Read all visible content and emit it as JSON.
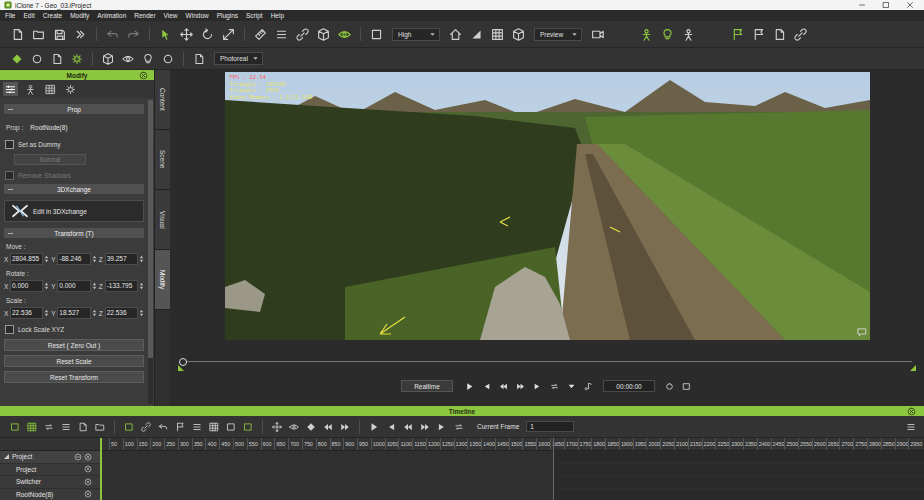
{
  "window": {
    "title": "iClone 7 - Geo_03.iProject"
  },
  "menu": [
    "File",
    "Edit",
    "Create",
    "Modify",
    "Animation",
    "Render",
    "View",
    "Window",
    "Plugins",
    "Script",
    "Help"
  ],
  "toolbar": {
    "quality": "High",
    "view_mode": "Preview",
    "render_mode": "Photoreal"
  },
  "modify_panel": {
    "title": "Modify",
    "icon_tabs": [
      {
        "selected": true
      },
      {
        "selected": false
      },
      {
        "selected": false
      },
      {
        "selected": false
      }
    ],
    "scrollbar": {
      "level": 0.85
    },
    "prop_section": {
      "title": "Prop",
      "prop_label": "Prop :",
      "prop_value": "RootNode(8)",
      "set_as_dummy": {
        "label": "Set as Dummy",
        "checked": false,
        "disabled": false
      },
      "shadow_mode": {
        "value": "Normal",
        "disabled": true
      },
      "remove_shadows": {
        "label": "Remove Shadows",
        "checked": false,
        "disabled": true
      }
    },
    "xchange_section": {
      "title": "3DXchange",
      "button": "Edit in 3DXchange"
    },
    "transform_section": {
      "title": "Transform (T)",
      "groups": [
        {
          "label": "Move :",
          "fields": [
            {
              "axis": "X",
              "value": "2804.855"
            },
            {
              "axis": "Y",
              "value": "-88.246"
            },
            {
              "axis": "Z",
              "value": "39.257"
            }
          ]
        },
        {
          "label": "Rotate :",
          "fields": [
            {
              "axis": "X",
              "value": "0.000"
            },
            {
              "axis": "Y",
              "value": "0.000"
            },
            {
              "axis": "Z",
              "value": "-133.795"
            }
          ]
        },
        {
          "label": "Scale :",
          "fields": [
            {
              "axis": "X",
              "value": "22.536"
            },
            {
              "axis": "Y",
              "value": "18.527"
            },
            {
              "axis": "Z",
              "value": "22.536"
            }
          ]
        }
      ],
      "lock_scale": {
        "label": "Lock Scale XYZ",
        "checked": false,
        "disabled": false
      },
      "buttons": [
        "Reset ( Zero Out )",
        "Reset Scale",
        "Reset Transform"
      ]
    }
  },
  "side_tabs": [
    {
      "label": "Content",
      "selected": false
    },
    {
      "label": "Scene",
      "selected": false
    },
    {
      "label": "Visual",
      "selected": false
    },
    {
      "label": "Modify",
      "selected": true
    }
  ],
  "viewport": {
    "stats": [
      "FPS : 22.54",
      "Triangle : 125120",
      "Triangle : 2762",
      "Video Memory : 1.1/11.1GB"
    ]
  },
  "playback": {
    "mode": "Realtime",
    "time": "00:00:00",
    "level": 0
  },
  "timeline": {
    "title": "Timeline",
    "current_frame_label": "Current Frame",
    "current_frame": "1",
    "ruler": [
      "50",
      "100",
      "150",
      "200",
      "250",
      "300",
      "350",
      "400",
      "450",
      "500",
      "550",
      "600",
      "650",
      "700",
      "750",
      "800",
      "850",
      "900",
      "950",
      "1000",
      "1050",
      "1100",
      "1150",
      "1200",
      "1250",
      "1300",
      "1350",
      "1400",
      "1450",
      "1500",
      "1550",
      "1600",
      "1650",
      "1700",
      "1750",
      "1800",
      "1850",
      "1900",
      "1950",
      "2000",
      "2050",
      "2100",
      "2150",
      "2200",
      "2250",
      "2300",
      "2350",
      "2400",
      "2450",
      "2500",
      "2550",
      "2600",
      "2650",
      "2700",
      "2750",
      "2800",
      "2850",
      "2900",
      "2950"
    ],
    "tracks": [
      {
        "label": "Project",
        "kind": "group",
        "expanded": true
      },
      {
        "label": "Project",
        "kind": "track",
        "expanded": false
      },
      {
        "label": "Switcher",
        "kind": "track",
        "expanded": false
      },
      {
        "label": "RootNode(8)",
        "kind": "track",
        "expanded": false
      }
    ]
  }
}
